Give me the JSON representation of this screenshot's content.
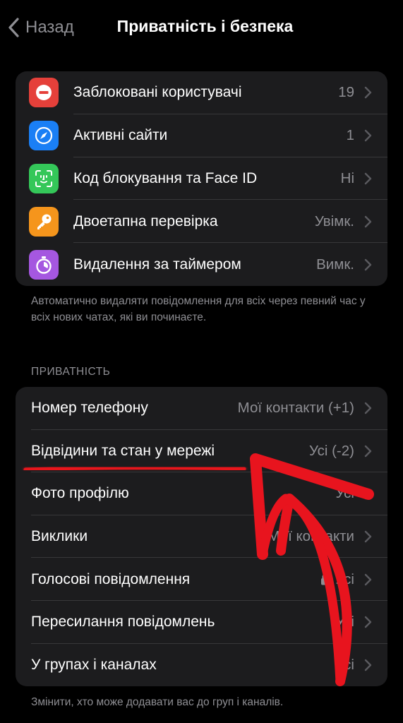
{
  "nav": {
    "back_label": "Назад",
    "title": "Приватність і безпека"
  },
  "security": {
    "items": [
      {
        "label": "Заблоковані користувачі",
        "value": "19",
        "icon": "blocked-icon",
        "color": "#e5403a"
      },
      {
        "label": "Активні сайти",
        "value": "1",
        "icon": "compass-icon",
        "color": "#1a7ff5"
      },
      {
        "label": "Код блокування та Face ID",
        "value": "Ні",
        "icon": "face-id-icon",
        "color": "#34c759"
      },
      {
        "label": "Двоетапна перевірка",
        "value": "Увімк.",
        "icon": "key-icon",
        "color": "#f5951c"
      },
      {
        "label": "Видалення за таймером",
        "value": "Вимк.",
        "icon": "timer-icon",
        "color": "#a557e0"
      }
    ],
    "footnote": "Автоматично видаляти повідомлення для всіх через певний час у всіх нових чатах, які ви починаєте."
  },
  "privacy": {
    "header": "ПРИВАТНІСТЬ",
    "items": [
      {
        "label": "Номер телефону",
        "value": "Мої контакти (+1)"
      },
      {
        "label": "Відвідини та стан у мережі",
        "value": "Усі (-2)"
      },
      {
        "label": "Фото профілю",
        "value": "Усі"
      },
      {
        "label": "Виклики",
        "value": "Мої контакти"
      },
      {
        "label": "Голосові повідомлення",
        "value": "Усі",
        "locked": true
      },
      {
        "label": "Пересилання повідомлень",
        "value": "Усі"
      },
      {
        "label": "У групах і каналах",
        "value": "Усі"
      }
    ],
    "footnote": "Змінити, хто може додавати вас до груп і каналів."
  },
  "colors": {
    "background": "#000000",
    "cell": "#1c1c1e",
    "secondary_text": "#8e8e93",
    "annotation_red": "#e8141e"
  }
}
